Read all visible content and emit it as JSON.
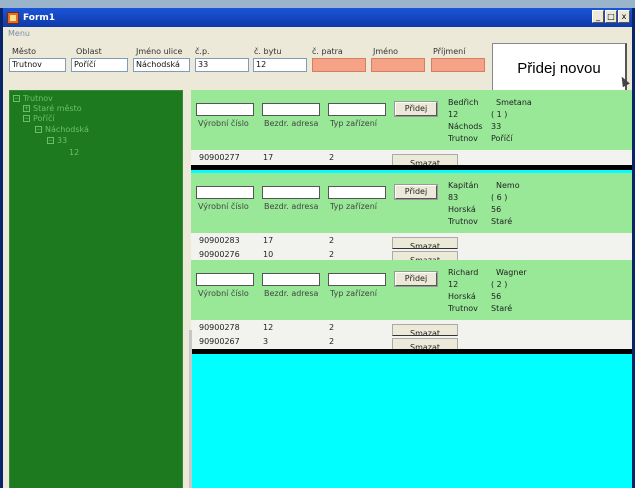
{
  "window": {
    "title": "Form1",
    "buttons": [
      "_",
      "□",
      "x"
    ]
  },
  "menu": {
    "label": "Menu"
  },
  "filters": [
    {
      "label": "Město",
      "value": "Trutnov"
    },
    {
      "label": "Oblast",
      "value": "Poříčí"
    },
    {
      "label": "Jméno ulice",
      "value": "Náchodská"
    },
    {
      "label": "č.p.",
      "value": "33"
    },
    {
      "label": "č. bytu",
      "value": "12"
    },
    {
      "label": "č. patra",
      "value": ""
    },
    {
      "label": "Jméno",
      "value": ""
    },
    {
      "label": "Příjmení",
      "value": ""
    }
  ],
  "add_button": "Přidej novou",
  "tree": [
    "Trutnov",
    "Staré město",
    "Poříčí",
    "Náchodská",
    "33",
    "12"
  ],
  "table_headers": [
    "Výrobní číslo",
    "Bezdr. adresa",
    "Typ zařízení"
  ],
  "add_label": "Přidej",
  "delete_label": "Smazat",
  "owners": [
    {
      "first": "Bedřich",
      "last": "Smetana",
      "flat": "12",
      "floor": "( 1 )",
      "street": "Náchods",
      "number": "33",
      "city": "Trutnov",
      "area": "Poříčí",
      "devices": [
        {
          "serial": "90900277",
          "addr": "17",
          "type": "2"
        }
      ]
    },
    {
      "first": "Kapitán",
      "last": "Nemo",
      "flat": "83",
      "floor": "( 6 )",
      "street": "Horská",
      "number": "56",
      "city": "Trutnov",
      "area": "Staré",
      "devices": [
        {
          "serial": "90900283",
          "addr": "17",
          "type": "2"
        },
        {
          "serial": "90900276",
          "addr": "10",
          "type": "2"
        }
      ]
    },
    {
      "first": "Richard",
      "last": "Wagner",
      "flat": "12",
      "floor": "( 2 )",
      "street": "Horská",
      "number": "56",
      "city": "Trutnov",
      "area": "Staré",
      "devices": [
        {
          "serial": "90900278",
          "addr": "12",
          "type": "2"
        },
        {
          "serial": "90900267",
          "addr": "3",
          "type": "2"
        }
      ]
    }
  ],
  "colors": {
    "title": "#0f3aa8",
    "tree": "#1e7a1e",
    "card": "#98e898",
    "empty": "#00ffff",
    "pink": "#f5a287"
  }
}
